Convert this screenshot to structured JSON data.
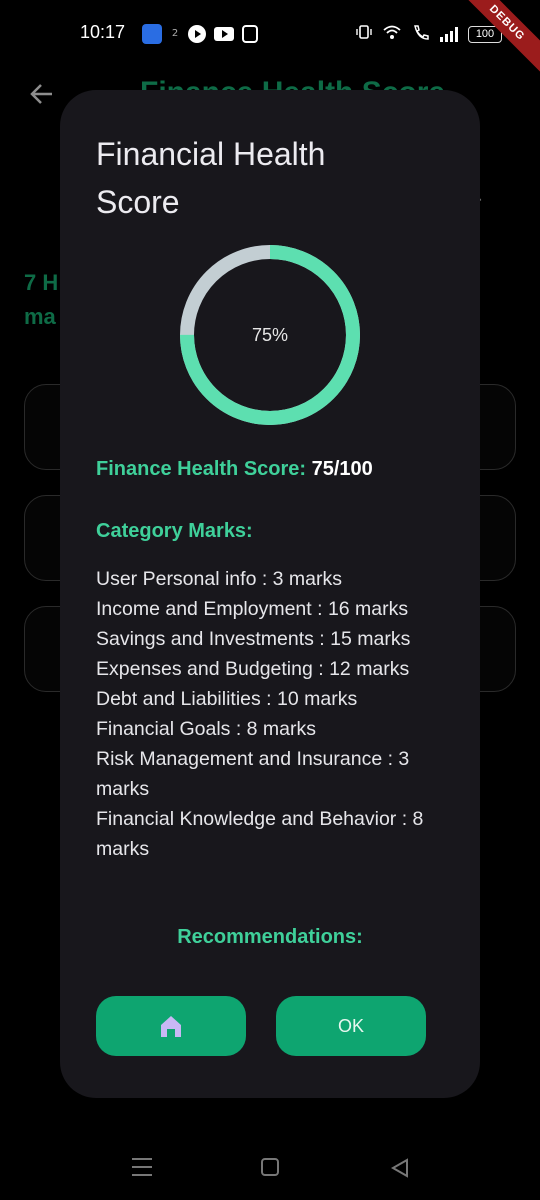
{
  "status_bar": {
    "time": "10:17",
    "battery": "100",
    "debug_label": "DEBUG"
  },
  "background": {
    "title": "Finance Health Score",
    "left_text_line1": "7 H",
    "left_text_line2": "ma",
    "right_fragment": "r"
  },
  "dialog": {
    "title": "Financial Health Score",
    "gauge": {
      "percent_label": "75%",
      "progress": 0.75,
      "progress_color": "#5ddfb0",
      "track_color": "#c3ced3"
    },
    "score": {
      "label": "Finance Health Score:",
      "value": "75/100"
    },
    "category_heading": "Category Marks:",
    "categories": [
      "User Personal info : 3 marks",
      "Income and Employment : 16 marks",
      "Savings and Investments : 15 marks",
      "Expenses and Budgeting : 12 marks",
      "Debt and Liabilities : 10 marks",
      "Financial Goals : 8 marks",
      "Risk Management and Insurance : 3 marks",
      "Financial Knowledge and Behavior : 8 marks"
    ],
    "recommendations_heading": "Recommendations:",
    "buttons": {
      "home_icon": "home-icon",
      "ok_label": "OK"
    }
  },
  "colors": {
    "accent_green": "#3fd09a",
    "button_green": "#0ea570",
    "dialog_bg": "#18171c",
    "home_icon_color": "#c9b8f5"
  }
}
